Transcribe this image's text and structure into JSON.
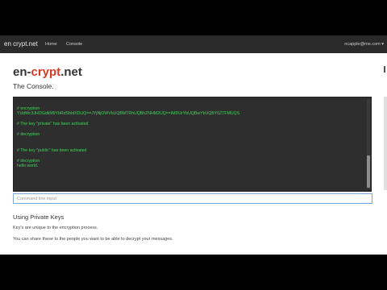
{
  "navbar": {
    "brand": "en crypt.net",
    "links": [
      "Home",
      "Console"
    ],
    "user": "ncapple@me.com ▾"
  },
  "header": {
    "title_part1": "en-",
    "title_part2": "crypt",
    "title_part3": ".net",
    "subtitle": "The Console."
  },
  "console": {
    "lines": [
      "",
      "# encryption",
      "YUdWc3JHOGdkM9YbRdSbIdXDUQ==JYjNjOWVbUQBMTRhUQBhZNHM2UQ==IMDUrYbUQBwYbUQBY0ZTFMUQS",
      "",
      "# The key \"private\" has been activated",
      "",
      "# decryption",
      "",
      "",
      "# The key \"public\" has been activated",
      "",
      "# decryption",
      "hello world."
    ]
  },
  "command_input": {
    "placeholder": "Command line input",
    "value": ""
  },
  "info": {
    "heading": "Using Private Keys",
    "para1": "Key's are unique to the encryption process.",
    "para2": "You can share these to the people you want to be able to decrypt your messages."
  },
  "colors": {
    "console_text": "#43d35b",
    "accent_red": "#d63a24",
    "navbar_bg": "#2a2a2a"
  }
}
